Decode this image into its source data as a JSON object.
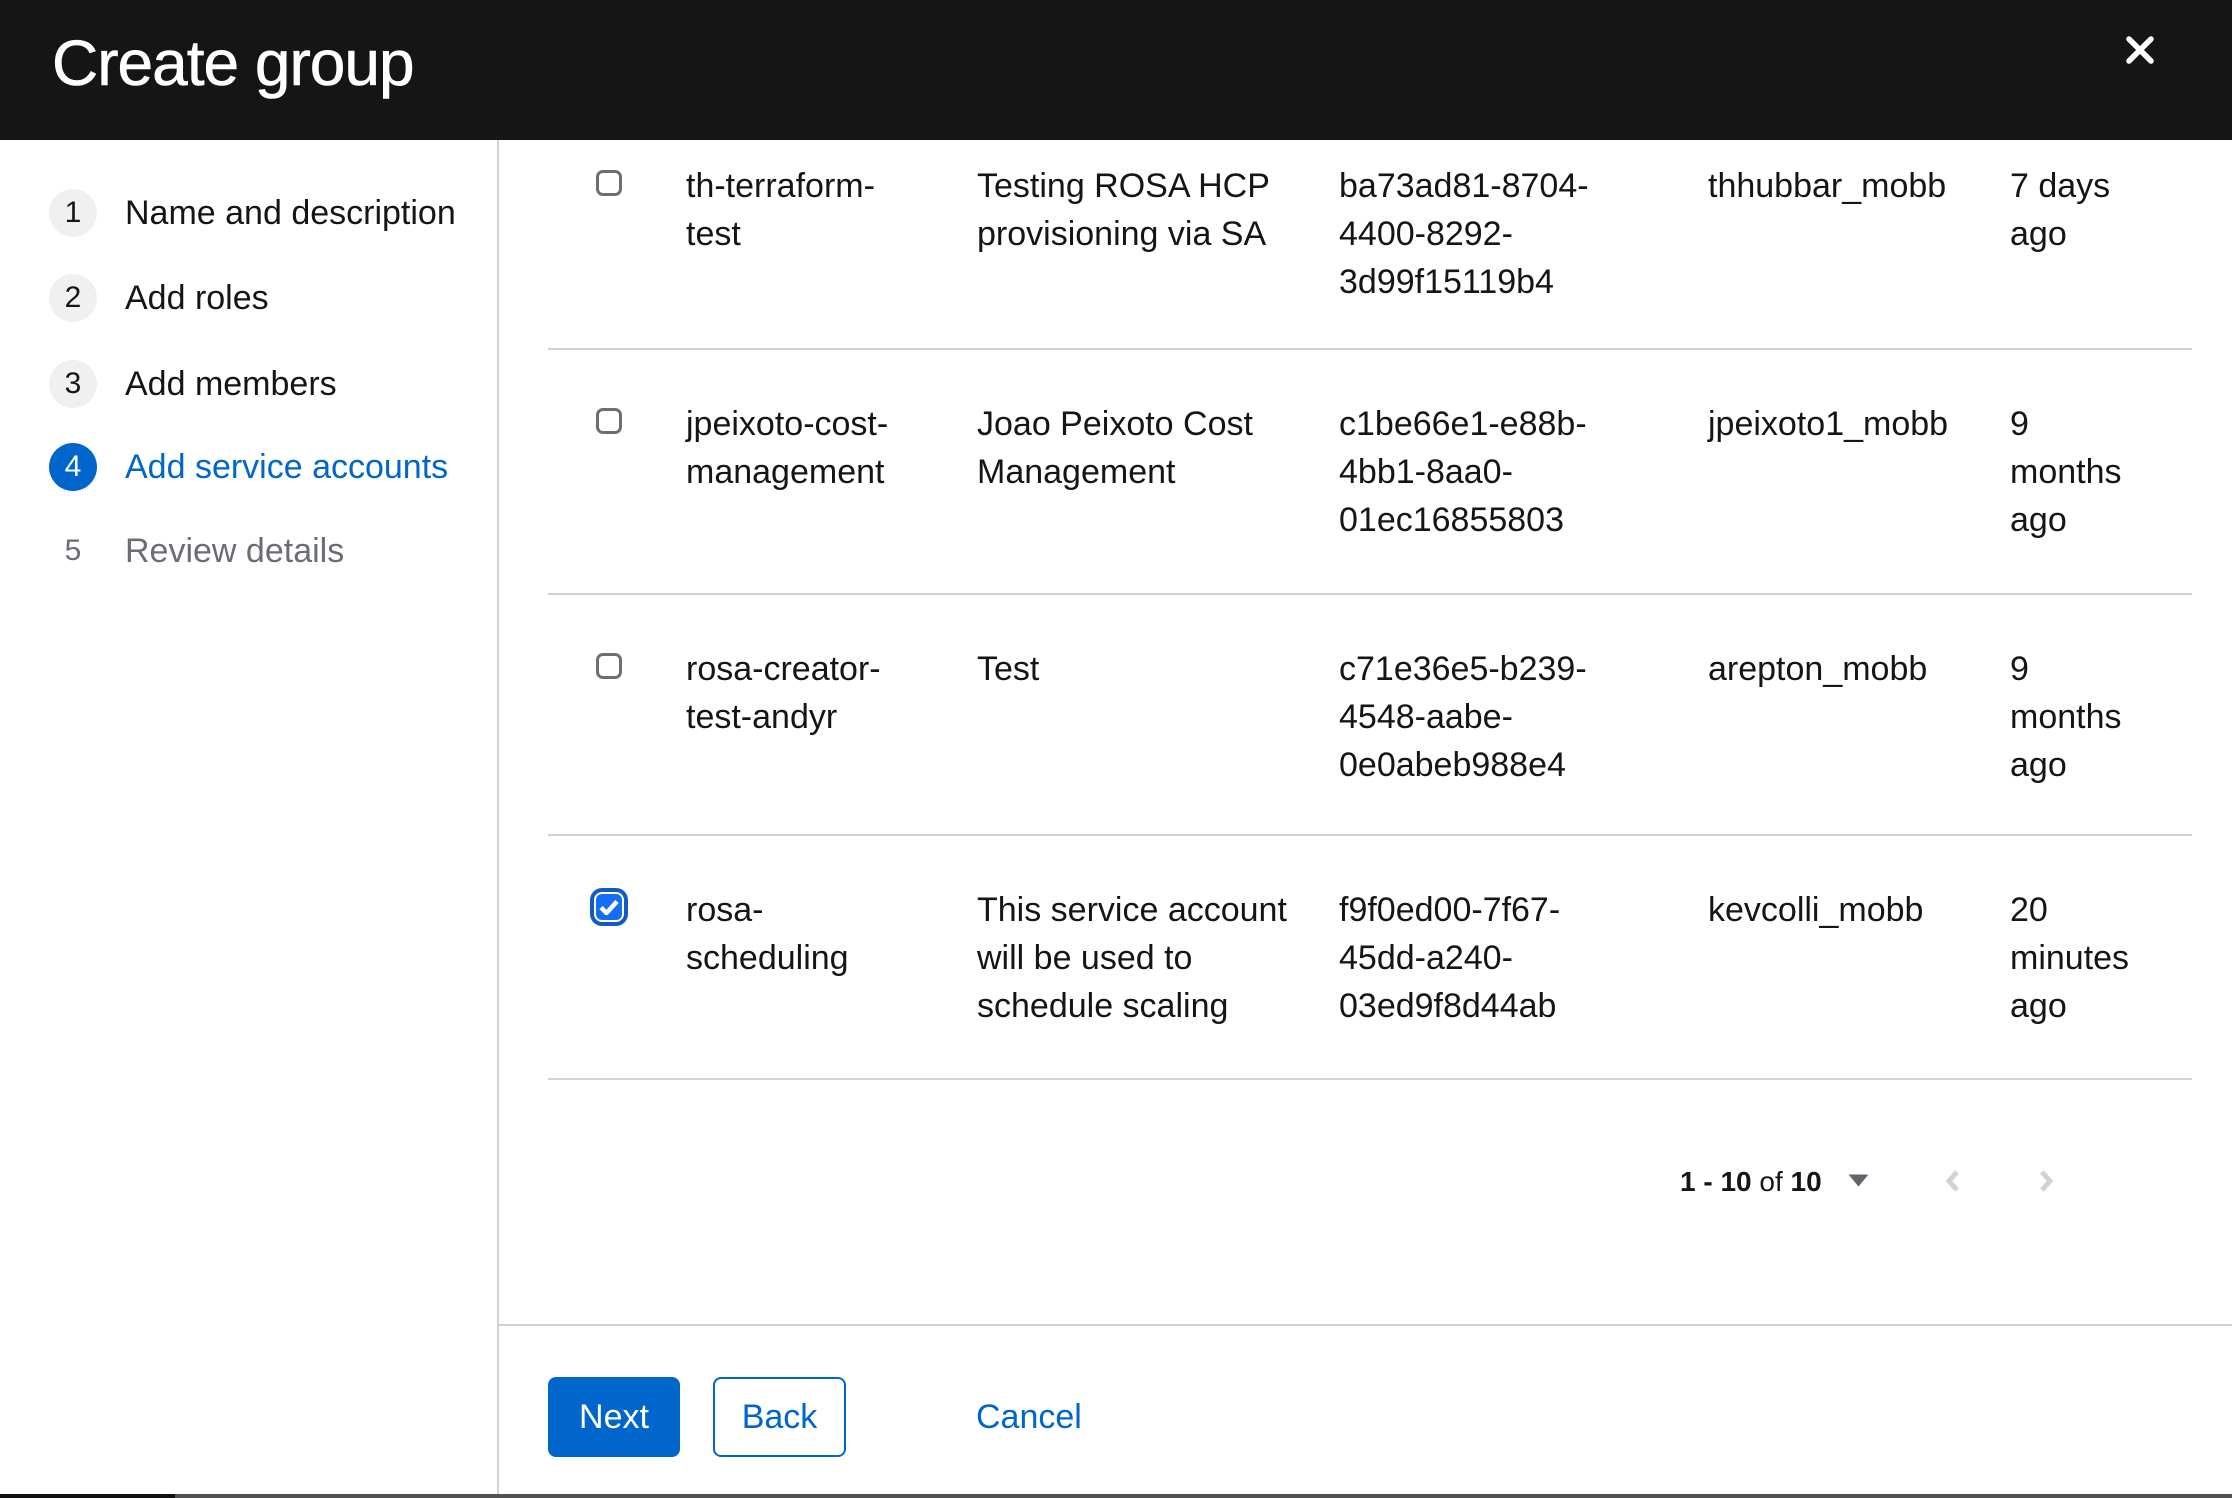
{
  "modal": {
    "title": "Create group"
  },
  "wizard_nav": {
    "steps": [
      {
        "number": "1",
        "label": "Name and description",
        "state": "visited"
      },
      {
        "number": "2",
        "label": "Add roles",
        "state": "visited"
      },
      {
        "number": "3",
        "label": "Add members",
        "state": "visited"
      },
      {
        "number": "4",
        "label": "Add service accounts",
        "state": "current"
      },
      {
        "number": "5",
        "label": "Review details",
        "state": "future"
      }
    ]
  },
  "table": {
    "rows": [
      {
        "selected": false,
        "name": "th-terraform-test",
        "description": "Testing ROSA HCP provisioning via SA",
        "client_id": "ba73ad81-8704-4400-8292-3d99f15119b4",
        "owner": "thhubbar_mobb",
        "time_created": "7 days ago"
      },
      {
        "selected": false,
        "name": "jpeixoto-cost-management",
        "description": "Joao Peixoto Cost Management",
        "client_id": "c1be66e1-e88b-4bb1-8aa0-01ec16855803",
        "owner": "jpeixoto1_mobb",
        "time_created": "9 months ago"
      },
      {
        "selected": false,
        "name": "rosa-creator-test-andyr",
        "description": "Test",
        "client_id": "c71e36e5-b239-4548-aabe-0e0abeb988e4",
        "owner": "arepton_mobb",
        "time_created": "9 months ago"
      },
      {
        "selected": true,
        "name": "rosa-scheduling",
        "description": "This service account will be used to schedule scaling",
        "client_id": "f9f0ed00-7f67-45dd-a240-03ed9f8d44ab",
        "owner": "kevcolli_mobb",
        "time_created": "20 minutes ago"
      }
    ]
  },
  "pagination": {
    "range": "1 - 10",
    "of_label": "of",
    "total": "10"
  },
  "footer": {
    "next_label": "Next",
    "back_label": "Back",
    "cancel_label": "Cancel"
  },
  "icons": {
    "close": "x-icon",
    "per_page_toggle": "caret-down-icon",
    "previous_page": "chevron-left-icon",
    "next_page": "chevron-right-icon",
    "checked": "checkmark-icon"
  },
  "colors": {
    "header_bg": "#151515",
    "accent": "#0066cc",
    "divider": "#d2d2d2",
    "text": "#151515",
    "muted_text": "#6a6e73",
    "step_circle_bg": "#f0f0f0",
    "checkbox_checked_fill": "#146ef5",
    "checkbox_checked_ring": "#1459c4",
    "chevron_disabled": "#d2d2d2",
    "caret": "#62656a"
  }
}
